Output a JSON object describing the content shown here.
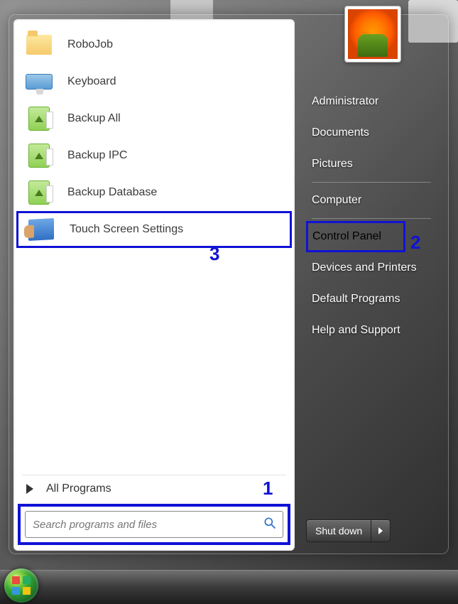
{
  "user_picture": "flower",
  "programs": [
    {
      "label": "RoboJob",
      "icon": "folder"
    },
    {
      "label": "Keyboard",
      "icon": "keyboard"
    },
    {
      "label": "Backup All",
      "icon": "backup"
    },
    {
      "label": "Backup IPC",
      "icon": "backup"
    },
    {
      "label": "Backup Database",
      "icon": "backup"
    },
    {
      "label": "Touch Screen Settings",
      "icon": "touch",
      "highlighted": true
    }
  ],
  "all_programs_label": "All Programs",
  "search_placeholder": "Search programs and files",
  "right_items_top": [
    "Administrator",
    "Documents",
    "Pictures"
  ],
  "right_items_mid": [
    "Computer"
  ],
  "right_items_bot": [
    "Control Panel",
    "Devices and Printers",
    "Default Programs",
    "Help and Support"
  ],
  "right_highlighted": "Control Panel",
  "shutdown_label": "Shut down",
  "callouts": {
    "search": "1",
    "control_panel": "2",
    "touch_settings": "3"
  }
}
